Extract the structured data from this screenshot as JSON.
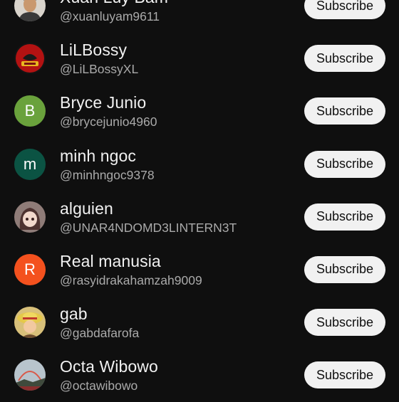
{
  "subscribe_label": "Subscribe",
  "channels": [
    {
      "name": "Xuan Luy Bam",
      "handle": "@xuanluyam9611",
      "avatar": {
        "type": "photo",
        "icon": "person-photo-icon"
      }
    },
    {
      "name": "LiLBossy",
      "handle": "@LiLBossyXL",
      "avatar": {
        "type": "photo",
        "icon": "boss-logo-icon"
      }
    },
    {
      "name": "Bryce Junio",
      "handle": "@brycejunio4960",
      "avatar": {
        "type": "letter",
        "letter": "B",
        "color": "#6aa23c"
      }
    },
    {
      "name": "minh ngoc",
      "handle": "@minhngoc9378",
      "avatar": {
        "type": "letter",
        "letter": "m",
        "color": "#0b5343"
      }
    },
    {
      "name": "alguien",
      "handle": "@UNAR4NDOMD3LINTERN3T",
      "avatar": {
        "type": "photo",
        "icon": "anime-girl-icon"
      }
    },
    {
      "name": "Real manusia",
      "handle": "@rasyidrakahamzah9009",
      "avatar": {
        "type": "letter",
        "letter": "R",
        "color": "#f4511e"
      }
    },
    {
      "name": "gab",
      "handle": "@gabdafarofa",
      "avatar": {
        "type": "photo",
        "icon": "straw-hat-character-icon"
      }
    },
    {
      "name": "Octa Wibowo",
      "handle": "@octawibowo",
      "avatar": {
        "type": "photo",
        "icon": "landscape-photo-icon"
      }
    }
  ]
}
